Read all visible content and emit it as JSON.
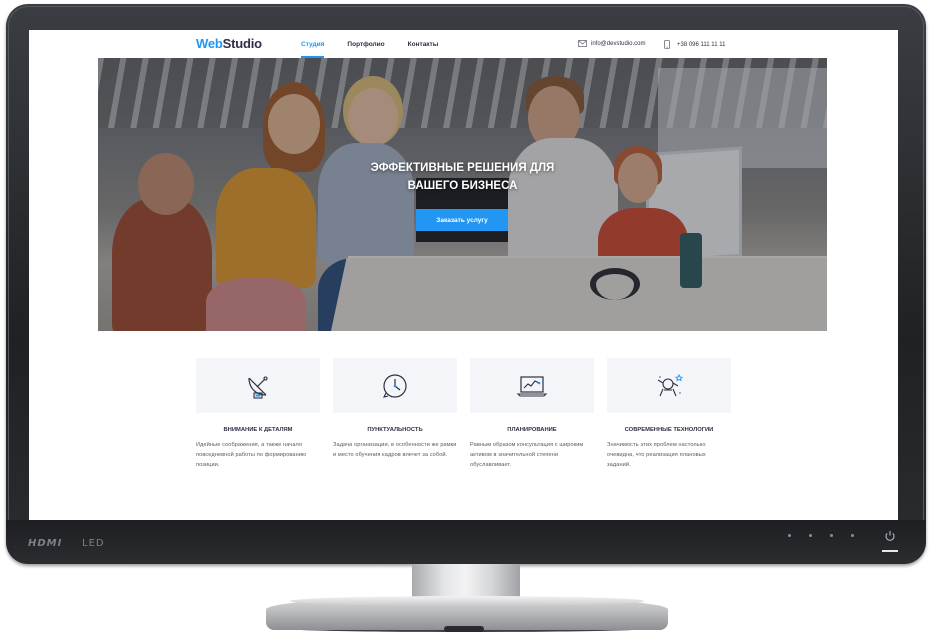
{
  "site": {
    "logo_part1": "Web",
    "logo_part2": "Studio",
    "nav": [
      {
        "label": "Студия",
        "active": true
      },
      {
        "label": "Портфолио",
        "active": false
      },
      {
        "label": "Контакты",
        "active": false
      }
    ],
    "email": "info@devstudio.com",
    "phone": "+38 096 111 11 11"
  },
  "hero": {
    "title_line1": "ЭФФЕКТИВНЫЕ РЕШЕНИЯ ДЛЯ",
    "title_line2": "ВАШЕГО БИЗНЕСА",
    "button": "Заказать услугу"
  },
  "features": [
    {
      "icon": "satellite-dish-icon",
      "title": "ВНИМАНИЕ К ДЕТАЛЯМ",
      "text": "Идейные соображения, а также начало повседневной работы по формированию позиции."
    },
    {
      "icon": "clock-icon",
      "title": "ПУНКТУАЛЬНОСТЬ",
      "text": "Задача организации, в особенности же рамки и место обучения кадров влечет за собой."
    },
    {
      "icon": "laptop-chart-icon",
      "title": "ПЛАНИРОВАНИЕ",
      "text": "Равным образом консультация с широким активом в значительной степени обуславливает."
    },
    {
      "icon": "astronaut-icon",
      "title": "СОВРЕМЕННЫЕ ТЕХНОЛОГИИ",
      "text": "Значимость этих проблем настолько очевидна, что реализация плановых заданий."
    }
  ],
  "monitor": {
    "brand": "HDMI",
    "type": "LED"
  },
  "colors": {
    "accent": "#2196f3",
    "dark_text": "#2e2f42",
    "feature_bg": "#f4f5f9"
  }
}
